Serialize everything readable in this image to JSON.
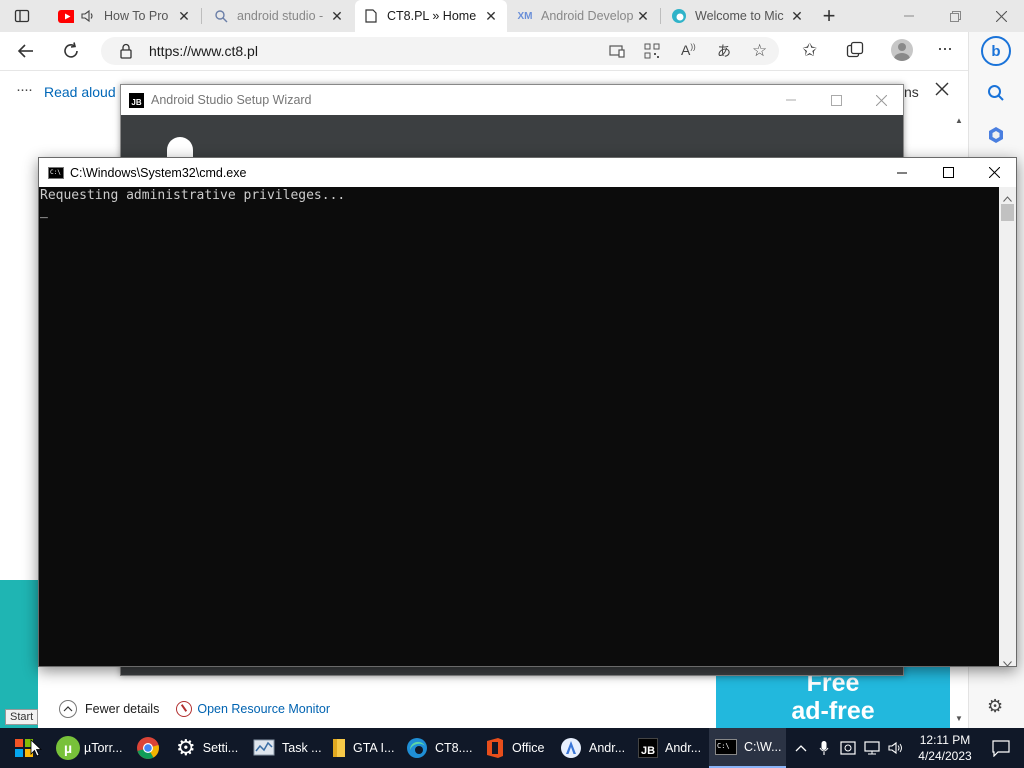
{
  "browser": {
    "tabs": [
      {
        "label": "How To Pro",
        "icon": "youtube-icon"
      },
      {
        "label": "android studio -",
        "icon": "search-icon"
      },
      {
        "label": "CT8.PL » Home",
        "icon": "page-icon",
        "active": true
      },
      {
        "label": "Android Develop",
        "icon": "xm-icon"
      },
      {
        "label": "Welcome to Mic",
        "icon": "edge-icon"
      }
    ],
    "new_tab": "+",
    "url": "https://www.ct8.pl",
    "read_aloud": "Read aloud",
    "readbar_fragment": "ns"
  },
  "wizard": {
    "badge": "JB",
    "title": "Android Studio Setup Wizard"
  },
  "cmd": {
    "title": "C:\\Windows\\System32\\cmd.exe",
    "output": "Requesting administrative privileges...",
    "cursor": "_"
  },
  "taskmgr": {
    "fewer_details": "Fewer details",
    "open_resource_monitor": "Open Resource Monitor"
  },
  "ad": {
    "line1": "Free",
    "line2": "ad-free"
  },
  "taskbar": {
    "start_tip": "Start",
    "items": [
      {
        "label": "µTorr...",
        "icon": "utorrent-icon"
      },
      {
        "label": "",
        "icon": "chrome-icon"
      },
      {
        "label": "Setti...",
        "icon": "settings-icon"
      },
      {
        "label": "Task ...",
        "icon": "task-manager-icon"
      },
      {
        "label": "GTA I...",
        "icon": "folder-icon"
      },
      {
        "label": "CT8....",
        "icon": "edge-icon"
      },
      {
        "label": "Office",
        "icon": "office-icon"
      },
      {
        "label": "Andr...",
        "icon": "android-studio-icon"
      },
      {
        "label": "Andr...",
        "icon": "jetbrains-icon"
      },
      {
        "label": "C:\\W...",
        "icon": "cmd-icon",
        "active": true
      }
    ],
    "time": "12:11 PM",
    "date": "4/24/2023"
  },
  "colors": {
    "taskbar": "#101828",
    "teal": "#1fb5b3",
    "ad_blue": "#22b8dd",
    "cmd_bg": "#0c0c0c"
  }
}
